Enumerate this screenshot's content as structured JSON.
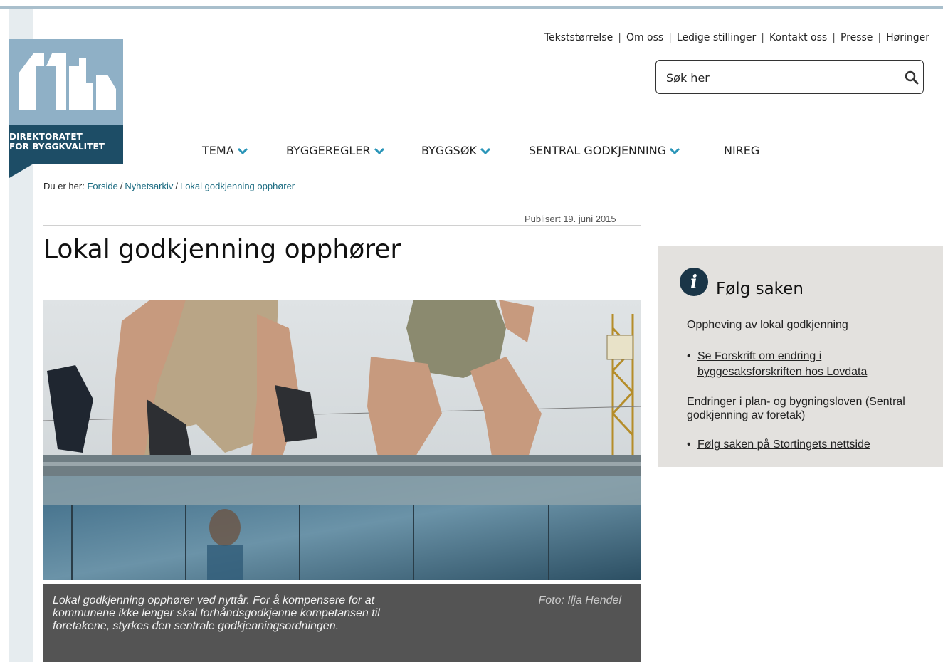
{
  "colors": {
    "brand_dark": "#1d4d66",
    "brand_light": "#8fb0c6",
    "link": "#1a6a80",
    "nav_chevron": "#2a95b8",
    "caption_bg": "#545454",
    "sidebar_bg": "#e3e1de"
  },
  "logo": {
    "line1": "DIREKTORATET",
    "line2": "FOR BYGGKVALITET"
  },
  "utility_nav": [
    "Tekststørrelse",
    "Om oss",
    "Ledige stillinger",
    "Kontakt oss",
    "Presse",
    "Høringer"
  ],
  "search": {
    "placeholder": "Søk her",
    "icon": "search-icon"
  },
  "main_nav": [
    {
      "label": "TEMA",
      "has_dropdown": true
    },
    {
      "label": "BYGGEREGLER",
      "has_dropdown": true
    },
    {
      "label": "BYGGSØK",
      "has_dropdown": true
    },
    {
      "label": "SENTRAL GODKJENNING",
      "has_dropdown": true
    },
    {
      "label": "NIREG",
      "has_dropdown": false
    }
  ],
  "breadcrumb": {
    "prefix": "Du er her:",
    "items": [
      "Forside",
      "Nyhetsarkiv",
      "Lokal godkjenning opphører"
    ]
  },
  "article": {
    "published": "Publisert 19. juni 2015",
    "title": "Lokal godkjenning opphører",
    "caption": "Lokal godkjenning opphører ved nyttår. For å kompensere for at kommunene ikke lenger skal forhåndsgodkjenne kompetansen til foretakene, styrkes den sentrale godkjenningsordningen.",
    "photo_credit": "Foto: Ilja Hendel"
  },
  "sidebar": {
    "icon": "info-icon",
    "title": "Følg saken",
    "section1_text": "Oppheving av lokal godkjenning",
    "section1_link": "Se Forskrift om endring i byggesaksforskriften hos Lovdata",
    "section2_text": "Endringer i plan- og bygningsloven (Sentral godkjenning av foretak)",
    "section2_link": "Følg saken på Stortingets nettside "
  }
}
